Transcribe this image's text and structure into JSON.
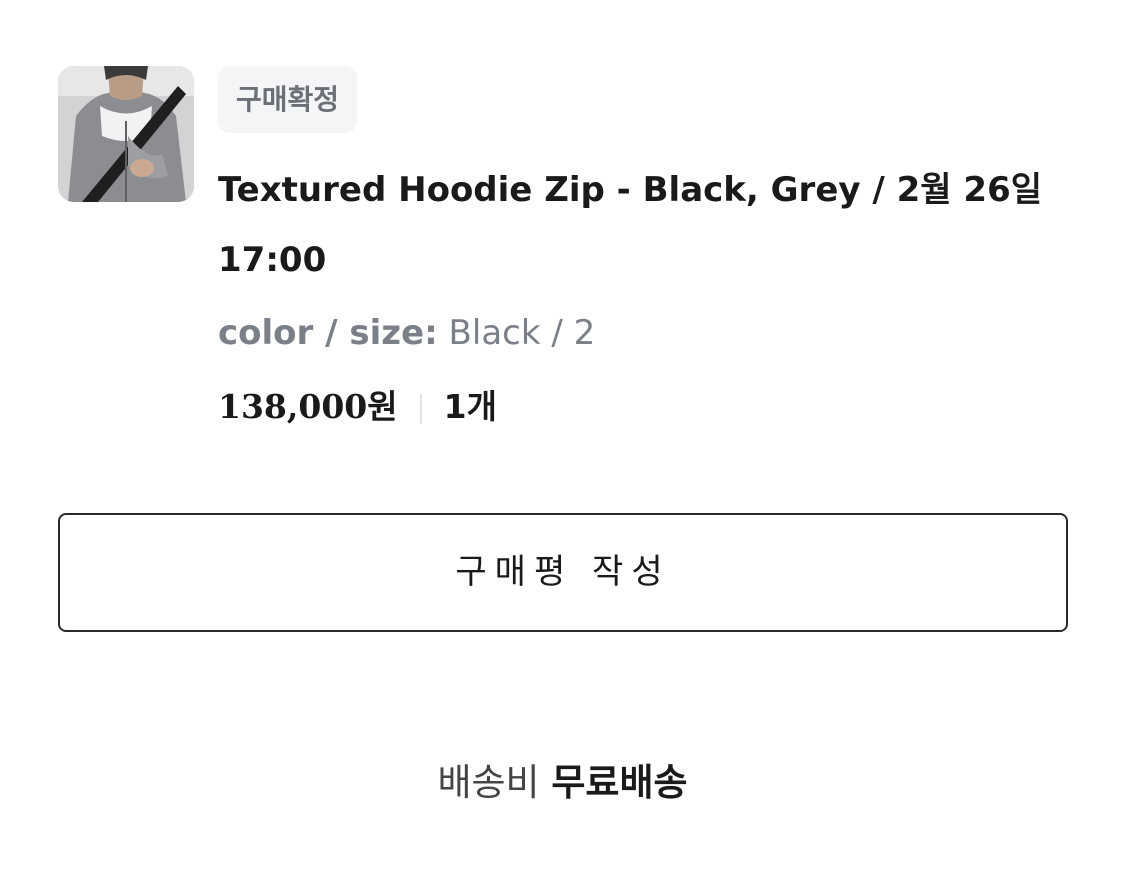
{
  "order": {
    "status": "구매확정",
    "product_title": "Textured Hoodie Zip - Black, Grey / 2월 26일 17:00",
    "option_label": "color / size:",
    "option_value": "Black / 2",
    "price": "138,000원",
    "quantity": "1개",
    "thumbnail_icon": "product-photo-icon"
  },
  "review_button_label": "구매평 작성",
  "shipping": {
    "label": "배송비",
    "value": "무료배송"
  }
}
